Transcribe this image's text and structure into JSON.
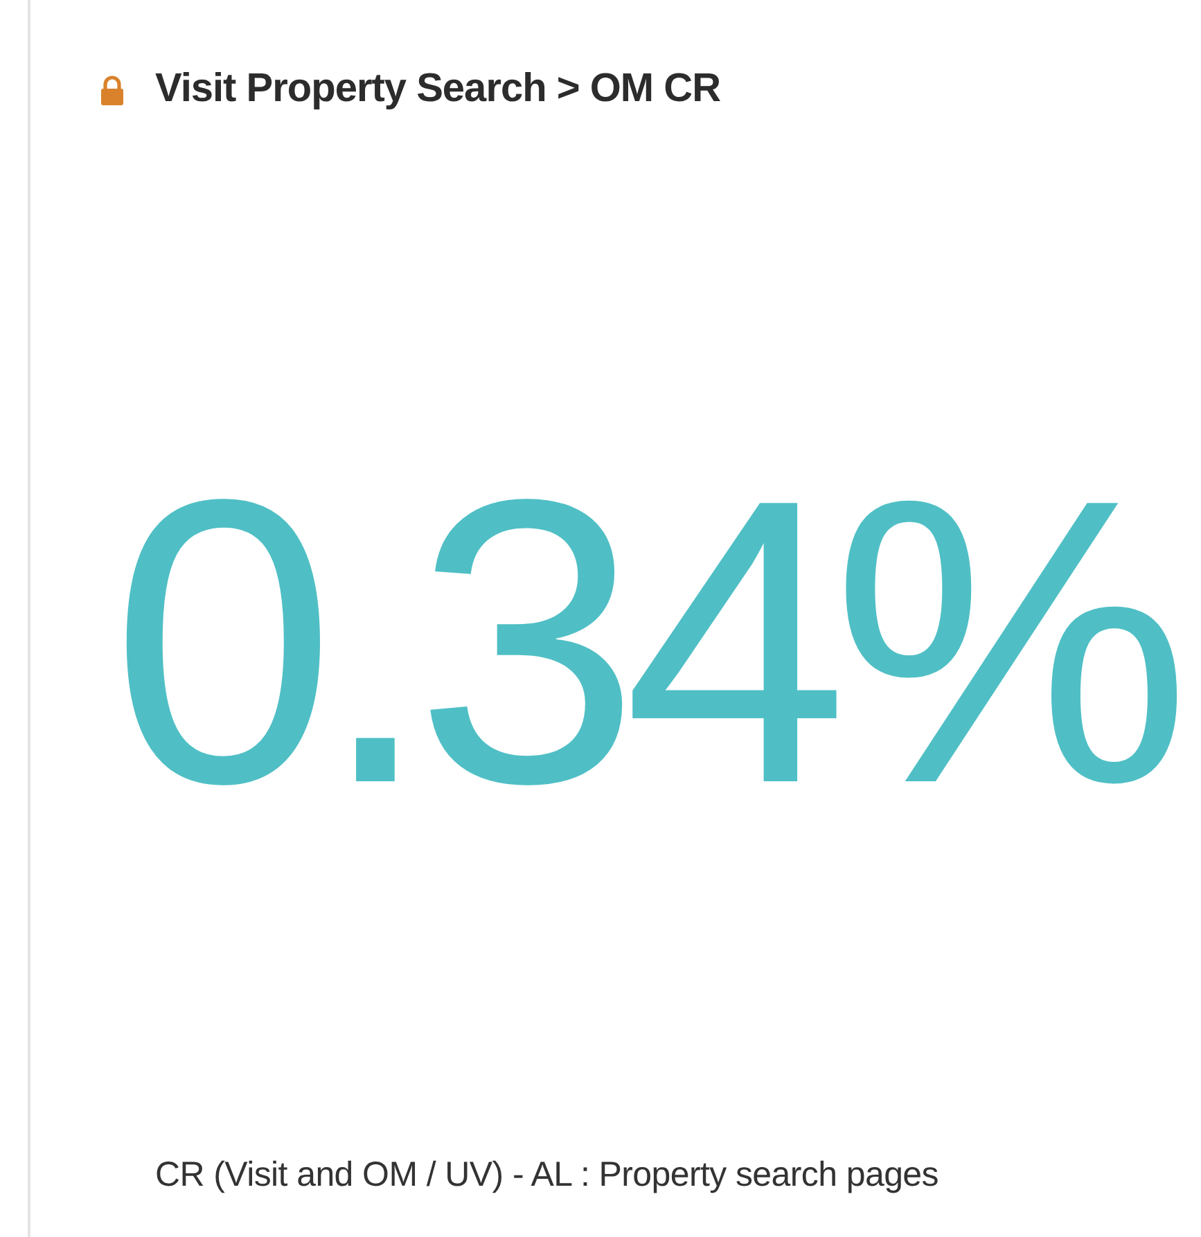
{
  "panel": {
    "locked": true,
    "title": "Visit Property Search > OM CR",
    "value": "0.34%",
    "description": "CR (Visit and OM / UV) - AL : Property search pages"
  }
}
